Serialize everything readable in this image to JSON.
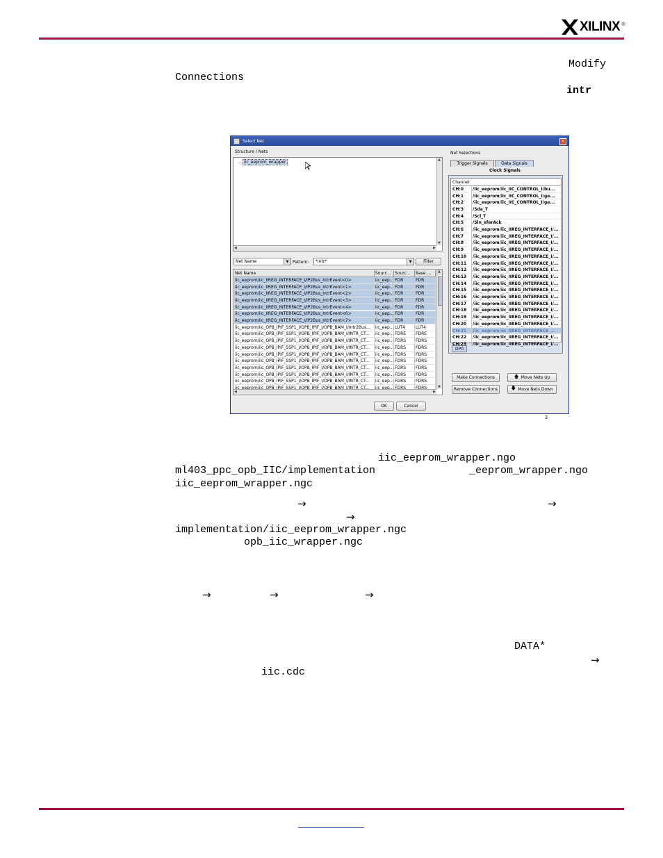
{
  "header": {
    "logo_text": "XILINX",
    "logo_reg": "®"
  },
  "body_text": {
    "modify": "Modify",
    "connections": "Connections",
    "intr": "intr",
    "ngo_file": "iic_eeprom_wrapper.ngo",
    "impl_path": "ml403_ppc_opb_IIC/implementation",
    "eeprom_ngo_suffix": "_eeprom_wrapper.ngo",
    "ngc_file": "iic_eeprom_wrapper.ngc",
    "impl_ngc_path": "implementation/iic_eeprom_wrapper.ngc",
    "opb_ngc": "opb_iic_wrapper.ngc",
    "data_star": "DATA*",
    "cdc_file": "iic.cdc",
    "arrow": "→"
  },
  "figure": {
    "number": "3"
  },
  "dialog": {
    "title": "Select Net",
    "structure_label": "Structure / Nets",
    "tree_item": "iic_eeprom_wrapper",
    "net_name_combo": "Net Name",
    "pattern_label": "Pattern:",
    "pattern_value": "*intr*",
    "filter_button": "Filter",
    "columns": [
      "Net Name",
      "Sourc...",
      "Sourc...",
      "Base ..."
    ],
    "nets": [
      {
        "name": "iic_eeprom/iic_IIREG_INTERFACE_I/IP2Bus_IntrEvent<0>",
        "s1": "iic_eep...",
        "s2": "FDR",
        "base": "FDR",
        "sel": true
      },
      {
        "name": "iic_eeprom/iic_IIREG_INTERFACE_I/IP2Bus_IntrEvent<1>",
        "s1": "iic_eep...",
        "s2": "FDR",
        "base": "FDR",
        "sel": true
      },
      {
        "name": "iic_eeprom/iic_IIREG_INTERFACE_I/IP2Bus_IntrEvent<2>",
        "s1": "iic_eep...",
        "s2": "FDR",
        "base": "FDR",
        "sel": true
      },
      {
        "name": "iic_eeprom/iic_IIREG_INTERFACE_I/IP2Bus_IntrEvent<3>",
        "s1": "iic_eep...",
        "s2": "FDR",
        "base": "FDR",
        "sel": true
      },
      {
        "name": "iic_eeprom/iic_IIREG_INTERFACE_I/IP2Bus_IntrEvent<4>",
        "s1": "iic_eep...",
        "s2": "FDR",
        "base": "FDR",
        "sel": true
      },
      {
        "name": "iic_eeprom/iic_IIREG_INTERFACE_I/IP2Bus_IntrEvent<6>",
        "s1": "iic_eep...",
        "s2": "FDR",
        "base": "FDR",
        "sel": true
      },
      {
        "name": "iic_eeprom/iic_IIREG_INTERFACE_I/IP2Bus_IntrEvent<7>",
        "s1": "iic_eep...",
        "s2": "FDR",
        "base": "FDR",
        "sel": true
      },
      {
        "name": "iic_eeprom/iic_OPB_IPIF_SSP1_I/OPB_IPIF_I/OPB_BAM_I/Intr2Bus...",
        "s1": "iic_eep...",
        "s2": "LUT4",
        "base": "LUT4",
        "sel": false
      },
      {
        "name": "iic_eeprom/iic_OPB_IPIF_SSP1_I/OPB_IPIF_I/OPB_BAM_I/INTR_CT...",
        "s1": "iic_eep...",
        "s2": "FDRE",
        "base": "FDRE",
        "sel": false
      },
      {
        "name": "iic_eeprom/iic_OPB_IPIF_SSP1_I/OPB_IPIF_I/OPB_BAM_I/INTR_CT...",
        "s1": "iic_eep...",
        "s2": "FDRS",
        "base": "FDRS",
        "sel": false
      },
      {
        "name": "iic_eeprom/iic_OPB_IPIF_SSP1_I/OPB_IPIF_I/OPB_BAM_I/INTR_CT...",
        "s1": "iic_eep...",
        "s2": "FDRS",
        "base": "FDRS",
        "sel": false
      },
      {
        "name": "iic_eeprom/iic_OPB_IPIF_SSP1_I/OPB_IPIF_I/OPB_BAM_I/INTR_CT...",
        "s1": "iic_eep...",
        "s2": "FDRS",
        "base": "FDRS",
        "sel": false
      },
      {
        "name": "iic_eeprom/iic_OPB_IPIF_SSP1_I/OPB_IPIF_I/OPB_BAM_I/INTR_CT...",
        "s1": "iic_eep...",
        "s2": "FDRS",
        "base": "FDRS",
        "sel": false
      },
      {
        "name": "iic_eeprom/iic_OPB_IPIF_SSP1_I/OPB_IPIF_I/OPB_BAM_I/INTR_CT...",
        "s1": "iic_eep...",
        "s2": "FDRS",
        "base": "FDRS",
        "sel": false
      },
      {
        "name": "iic_eeprom/iic_OPB_IPIF_SSP1_I/OPB_IPIF_I/OPB_BAM_I/INTR_CT...",
        "s1": "iic_eep...",
        "s2": "FDRS",
        "base": "FDRS",
        "sel": false
      },
      {
        "name": "iic_eeprom/iic_OPB_IPIF_SSP1_I/OPB_IPIF_I/OPB_BAM_I/INTR_CT...",
        "s1": "iic_eep...",
        "s2": "FDRS",
        "base": "FDRS",
        "sel": false
      },
      {
        "name": "iic_eeprom/iic_OPB_IPIF_SSP1_I/OPB_IPIF_I/OPB_BAM_I/INTR_CT...",
        "s1": "iic_eep...",
        "s2": "FDRS",
        "base": "FDRS",
        "sel": false
      }
    ],
    "net_selections_label": "Net Selections",
    "tab_trigger": "Trigger Signals",
    "tab_data": "Data Signals",
    "tab_clock": "Clock Signals",
    "channel_header": "Channel",
    "channels": [
      {
        "ch": "CH:0",
        "net": "/iic_eeprom/iic_IIC_CONTROL_I/bu...",
        "hl": false
      },
      {
        "ch": "CH:1",
        "net": "/iic_eeprom/iic_IIC_CONTROL_I/ge...",
        "hl": false
      },
      {
        "ch": "CH:2",
        "net": "/iic_eeprom/iic_IIC_CONTROL_I/ge...",
        "hl": false
      },
      {
        "ch": "CH:3",
        "net": "/Sda_T",
        "hl": false
      },
      {
        "ch": "CH:4",
        "net": "/Scl_T",
        "hl": false
      },
      {
        "ch": "CH:5",
        "net": "/Sln_xferAck",
        "hl": false
      },
      {
        "ch": "CH:6",
        "net": "/iic_eeprom/iic_IIREG_INTERFACE_I/...",
        "hl": false
      },
      {
        "ch": "CH:7",
        "net": "/iic_eeprom/iic_IIREG_INTERFACE_I/...",
        "hl": false
      },
      {
        "ch": "CH:8",
        "net": "/iic_eeprom/iic_IIREG_INTERFACE_I/...",
        "hl": false
      },
      {
        "ch": "CH:9",
        "net": "/iic_eeprom/iic_IIREG_INTERFACE_I/...",
        "hl": false
      },
      {
        "ch": "CH:10",
        "net": "/iic_eeprom/iic_IIREG_INTERFACE_I/...",
        "hl": false
      },
      {
        "ch": "CH:11",
        "net": "/iic_eeprom/iic_IIREG_INTERFACE_I/...",
        "hl": false
      },
      {
        "ch": "CH:12",
        "net": "/iic_eeprom/iic_IIREG_INTERFACE_I/...",
        "hl": false
      },
      {
        "ch": "CH:13",
        "net": "/iic_eeprom/iic_IIREG_INTERFACE_I/...",
        "hl": false
      },
      {
        "ch": "CH:14",
        "net": "/iic_eeprom/iic_IIREG_INTERFACE_I/...",
        "hl": false
      },
      {
        "ch": "CH:15",
        "net": "/iic_eeprom/iic_IIREG_INTERFACE_I/...",
        "hl": false
      },
      {
        "ch": "CH:16",
        "net": "/iic_eeprom/iic_IIREG_INTERFACE_I/...",
        "hl": false
      },
      {
        "ch": "CH:17",
        "net": "/iic_eeprom/iic_IIREG_INTERFACE_I/...",
        "hl": false
      },
      {
        "ch": "CH:18",
        "net": "/iic_eeprom/iic_IIREG_INTERFACE_I/...",
        "hl": false
      },
      {
        "ch": "CH:19",
        "net": "/iic_eeprom/iic_IIREG_INTERFACE_I/...",
        "hl": false
      },
      {
        "ch": "CH:20",
        "net": "/iic_eeprom/iic_IIREG_INTERFACE_I/...",
        "hl": false
      },
      {
        "ch": "CH:21",
        "net": "/iic_eeprom/iic_IIREG_INTERFACE_...",
        "hl": true
      },
      {
        "ch": "CH:22",
        "net": "/iic_eeprom/iic_IIREG_INTERFACE_I/...",
        "hl": false
      },
      {
        "ch": "CH:23",
        "net": "/iic_eeprom/iic_IIREG_INTERFACE_I/...",
        "hl": false
      }
    ],
    "dp_tab": "DP0",
    "make_connections": "Make Connections",
    "remove_connections": "Remove Connections",
    "move_up": "Move Nets Up",
    "move_down": "Move Nets Down",
    "ok": "OK",
    "cancel": "Cancel"
  },
  "colors": {
    "rule": "#a0153e",
    "selection": "#b8cce4",
    "titlebar": "#2a4c9c"
  }
}
